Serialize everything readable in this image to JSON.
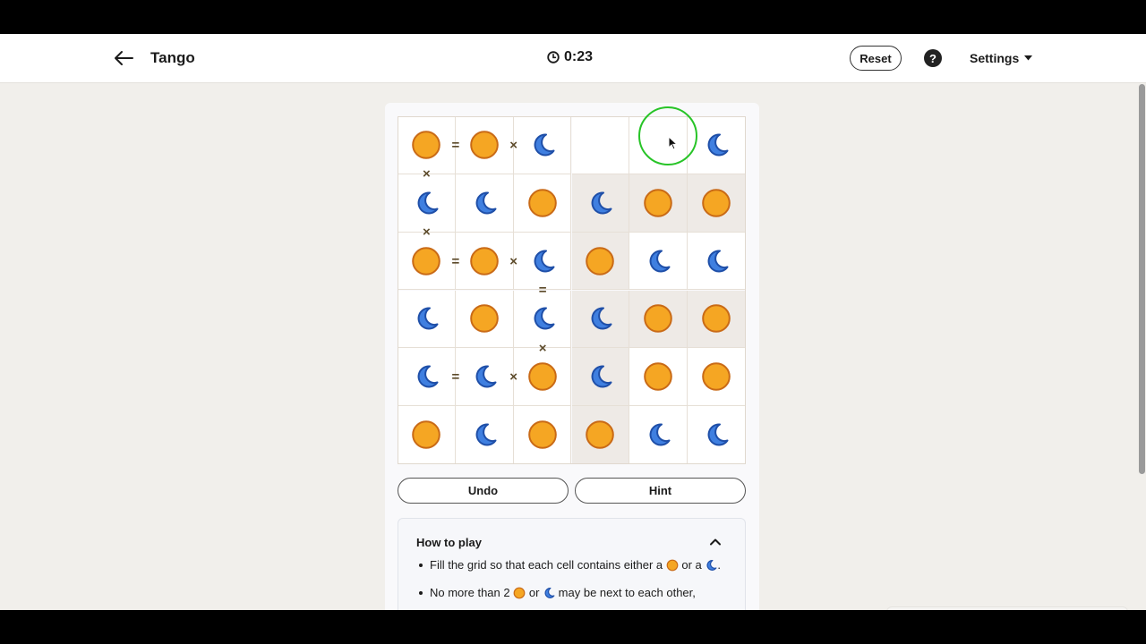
{
  "header": {
    "title": "Tango",
    "timer": "0:23",
    "reset_label": "Reset",
    "help_label": "?",
    "settings_label": "Settings"
  },
  "colors": {
    "sun": "#f5a623",
    "sun_stroke": "#c96a16",
    "moon": "#3f7fe0",
    "moon_stroke": "#1f4fa8",
    "locked_cell": "#eeeae6",
    "cursor_ring": "#28c428"
  },
  "grid": {
    "rows": 6,
    "cols": 6,
    "cells": [
      [
        "sun",
        "sun",
        "moon",
        "",
        "",
        "moon"
      ],
      [
        "moon",
        "moon",
        "sun",
        "moon",
        "sun",
        "sun"
      ],
      [
        "sun",
        "sun",
        "moon",
        "sun",
        "moon",
        "moon"
      ],
      [
        "moon",
        "sun",
        "moon",
        "moon",
        "sun",
        "sun"
      ],
      [
        "moon",
        "moon",
        "sun",
        "moon",
        "sun",
        "sun"
      ],
      [
        "sun",
        "moon",
        "sun",
        "sun",
        "moon",
        "moon"
      ]
    ],
    "locked": [
      [
        false,
        false,
        false,
        false,
        false,
        false
      ],
      [
        false,
        false,
        false,
        true,
        true,
        true
      ],
      [
        false,
        false,
        false,
        true,
        false,
        false
      ],
      [
        false,
        false,
        false,
        true,
        true,
        true
      ],
      [
        false,
        false,
        false,
        true,
        false,
        false
      ],
      [
        false,
        false,
        false,
        true,
        false,
        false
      ]
    ],
    "constraints_horizontal": [
      {
        "row": 0,
        "col": 0,
        "sign": "="
      },
      {
        "row": 0,
        "col": 1,
        "sign": "×"
      },
      {
        "row": 2,
        "col": 0,
        "sign": "="
      },
      {
        "row": 2,
        "col": 1,
        "sign": "×"
      },
      {
        "row": 4,
        "col": 0,
        "sign": "="
      },
      {
        "row": 4,
        "col": 1,
        "sign": "×"
      }
    ],
    "constraints_vertical": [
      {
        "row": 0,
        "col": 0,
        "sign": "×"
      },
      {
        "row": 1,
        "col": 0,
        "sign": "×"
      },
      {
        "row": 2,
        "col": 2,
        "sign": "="
      },
      {
        "row": 3,
        "col": 2,
        "sign": "×"
      }
    ]
  },
  "actions": {
    "undo_label": "Undo",
    "hint_label": "Hint"
  },
  "how_to_play": {
    "title": "How to play",
    "rule1_a": "Fill the grid so that each cell contains either a",
    "rule1_b": "or a",
    "rule1_c": ".",
    "rule2_a": "No more than 2",
    "rule2_b": "or",
    "rule2_c": "may be next to each other,"
  }
}
